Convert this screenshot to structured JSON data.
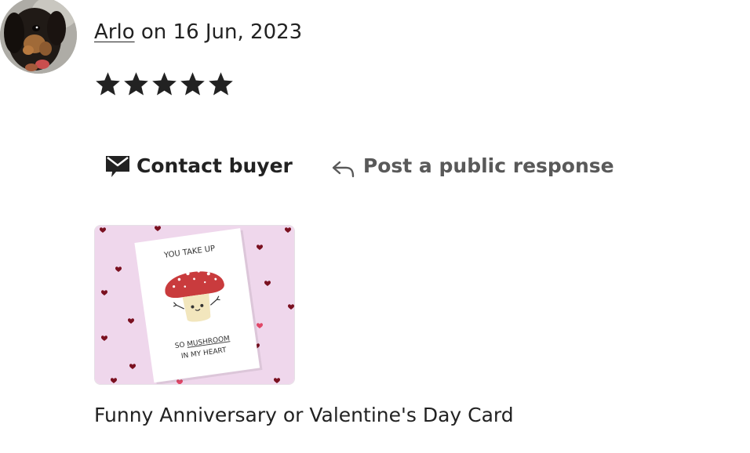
{
  "review": {
    "reviewer_name": "Arlo",
    "date_text": " on 16 Jun, 2023",
    "rating": 5,
    "rating_max": 5
  },
  "actions": {
    "contact_label": "Contact buyer",
    "respond_label": "Post a public response"
  },
  "icons": {
    "contact": "envelope-icon",
    "respond": "reply-arrow-icon",
    "star": "star-icon"
  },
  "listing": {
    "image_text_top": "YOU TAKE UP",
    "image_text_line2_prefix": "SO ",
    "image_text_line2_emph": "MUSHROOM",
    "image_text_line3": "IN MY HEART",
    "title": "Funny Anniversary or Valentine's Day Card"
  },
  "colors": {
    "text": "#222222",
    "muted": "#595959",
    "card_background": "#efd7ec",
    "mushroom_cap": "#c93b3d"
  }
}
